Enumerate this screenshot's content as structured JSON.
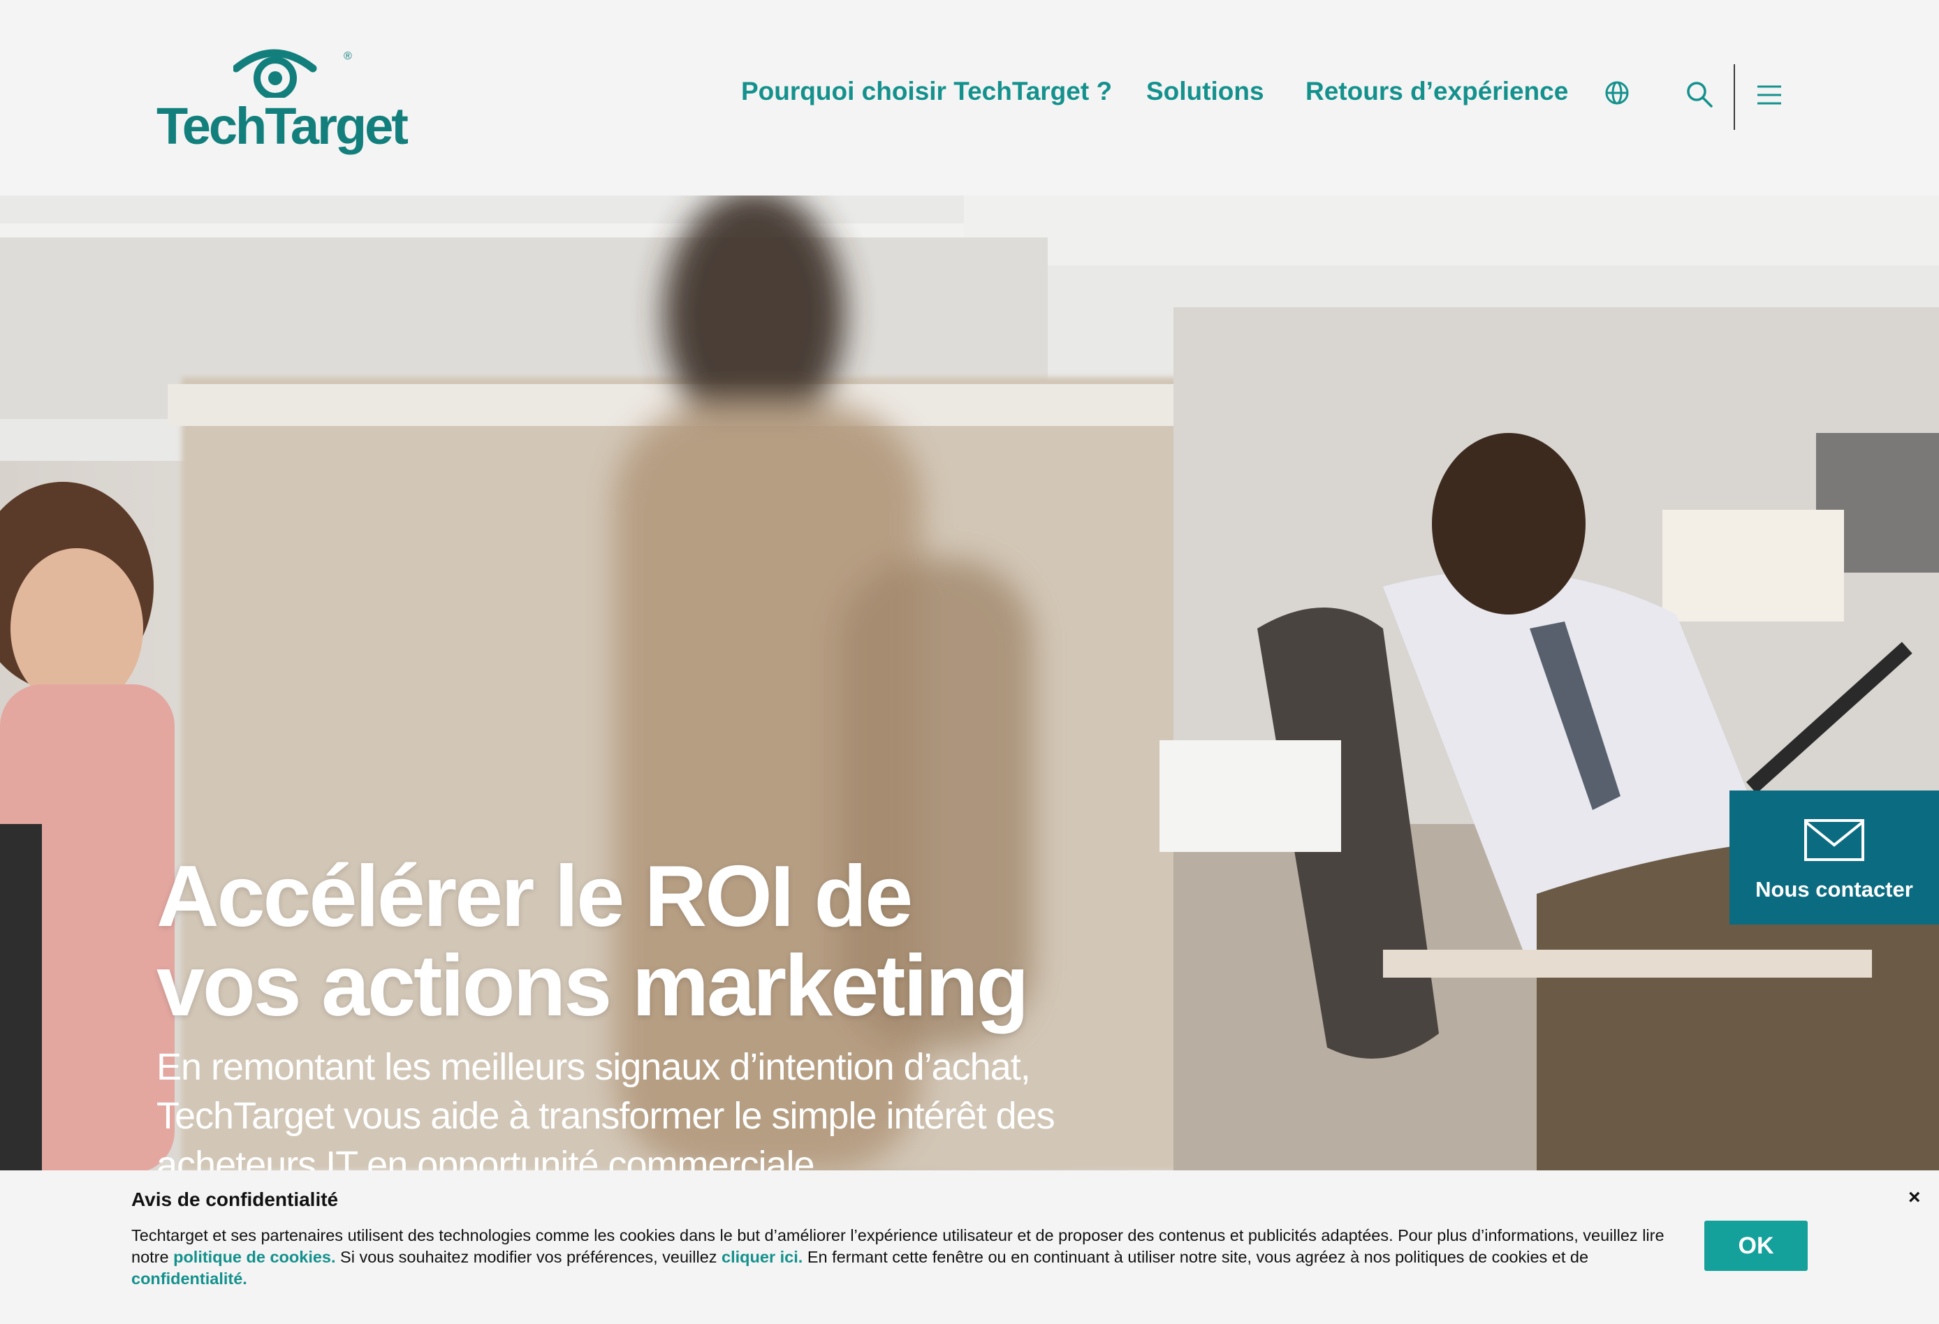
{
  "header": {
    "logo_text": "TechTarget",
    "logo_registered": "®",
    "nav": [
      {
        "label": "Pourquoi choisir TechTarget ?"
      },
      {
        "label": "Solutions"
      },
      {
        "label": "Retours d’expérience"
      }
    ],
    "icons": [
      "globe-icon",
      "search-icon",
      "menu-icon"
    ]
  },
  "hero": {
    "title_line1": "Accélérer le ROI de",
    "title_line2": "vos actions marketing",
    "subtitle_line1": "En remontant les meilleurs signaux d’intention d’achat,",
    "subtitle_line2": "TechTarget vous aide à transformer le simple intérêt des",
    "subtitle_line3": "acheteurs IT en opportunité commerciale.",
    "play_icon": "play-icon",
    "contact_label": "Nous contacter",
    "contact_icon": "mail-icon"
  },
  "cookie_banner": {
    "title": "Avis de confidentialité",
    "text_part1": "Techtarget et ses partenaires utilisent des technologies comme les cookies dans le but d’améliorer l’expérience utilisateur et de proposer des contenus et publicités adaptées. Pour plus d’informations, veuillez lire notre ",
    "link1": "politique de cookies.",
    "text_part2": " Si vous souhaitez modifier vos préférences, veuillez ",
    "link2": "cliquer ici.",
    "text_part3": " En fermant cette fenêtre ou en continuant à utiliser notre site, vous agréez à nos politiques de cookies et de ",
    "link3": "confidentialité.",
    "ok_label": "OK",
    "close_label": "×"
  },
  "colors": {
    "brand_teal": "#14918d",
    "logo_teal": "#127f7c",
    "contact_blue": "#0b6b80",
    "ok_button": "#14a09b",
    "background": "#f4f4f4"
  }
}
